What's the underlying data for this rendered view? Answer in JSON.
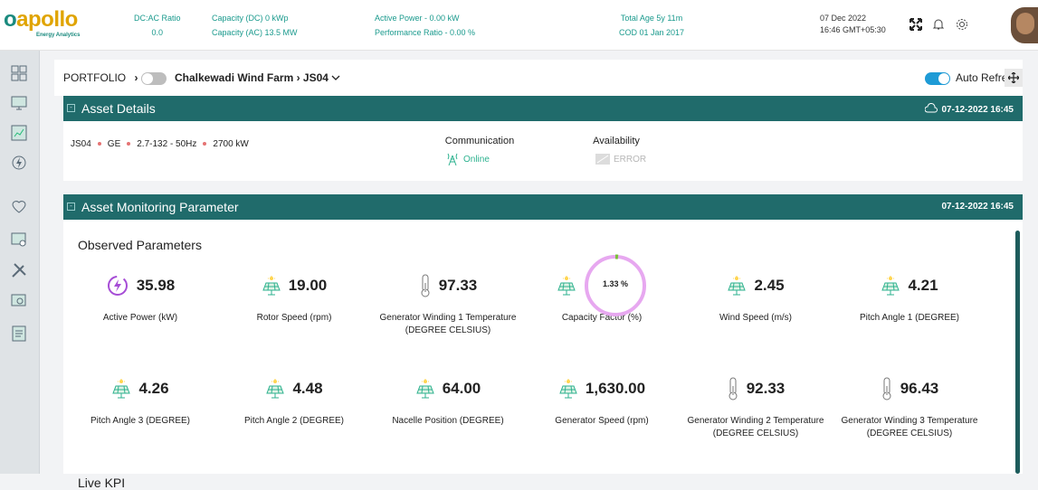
{
  "header": {
    "logo_text": "apollo",
    "logo_sub": "Energy Analytics",
    "stats": [
      {
        "label": "DC:AC Ratio",
        "value": "0.0"
      },
      {
        "label": "Capacity (DC) 0 kWp",
        "value": "Capacity (AC) 13.5 MW"
      },
      {
        "label": "Active Power - 0.00 kW",
        "value": "Performance Ratio - 0.00 %"
      },
      {
        "label": "Total Age 5y 11m",
        "value": "COD 01 Jan 2017"
      }
    ],
    "date": "07 Dec 2022",
    "time": "16:46 GMT+05:30"
  },
  "breadcrumb": {
    "portfolio": "PORTFOLIO",
    "sep": "›",
    "farm": "Chalkewadi Wind Farm › JS04",
    "auto_refresh": "Auto Refresh"
  },
  "asset_details": {
    "title": "Asset Details",
    "timestamp": "07-12-2022 16:45",
    "id": "JS04",
    "make": "GE",
    "model": "2.7-132 - 50Hz",
    "capacity": "2700 kW",
    "communication_label": "Communication",
    "communication_value": "Online",
    "availability_label": "Availability",
    "availability_value": "ERROR"
  },
  "monitoring": {
    "title": "Asset Monitoring Parameter",
    "timestamp": "07-12-2022 16:45",
    "observed_title": "Observed Parameters",
    "live_kpi_title": "Live KPI",
    "capacity_factor_fraction": 0.0133,
    "params": [
      {
        "value": "35.98",
        "label": "Active Power (kW)",
        "icon": "lightning-circle-icon"
      },
      {
        "value": "19.00",
        "label": "Rotor Speed (rpm)",
        "icon": "solar-panel-icon"
      },
      {
        "value": "97.33",
        "label": "Generator Winding 1 Temperature (DEGREE CELSIUS)",
        "icon": "thermometer-icon"
      },
      {
        "value": "1.33 %",
        "label": "Capacity Factor (%)",
        "icon": "solar-panel-icon"
      },
      {
        "value": "2.45",
        "label": "Wind Speed (m/s)",
        "icon": "solar-panel-icon"
      },
      {
        "value": "4.21",
        "label": "Pitch Angle 1 (DEGREE)",
        "icon": "solar-panel-icon"
      },
      {
        "value": "4.26",
        "label": "Pitch Angle 3 (DEGREE)",
        "icon": "solar-panel-icon"
      },
      {
        "value": "4.48",
        "label": "Pitch Angle 2 (DEGREE)",
        "icon": "solar-panel-icon"
      },
      {
        "value": "64.00",
        "label": "Nacelle Position (DEGREE)",
        "icon": "solar-panel-icon"
      },
      {
        "value": "1,630.00",
        "label": "Generator Speed (rpm)",
        "icon": "solar-panel-icon"
      },
      {
        "value": "92.33",
        "label": "Generator Winding 2 Temperature (DEGREE CELSIUS)",
        "icon": "thermometer-icon"
      },
      {
        "value": "96.43",
        "label": "Generator Winding 3 Temperature (DEGREE CELSIUS)",
        "icon": "thermometer-icon"
      }
    ]
  },
  "colors": {
    "teal_header": "#206b6b",
    "accent_green": "#2db28f",
    "ring_pink": "#e7a8f0",
    "ring_fill": "#7bbf3a",
    "toggle_on": "#1e9bd6"
  }
}
